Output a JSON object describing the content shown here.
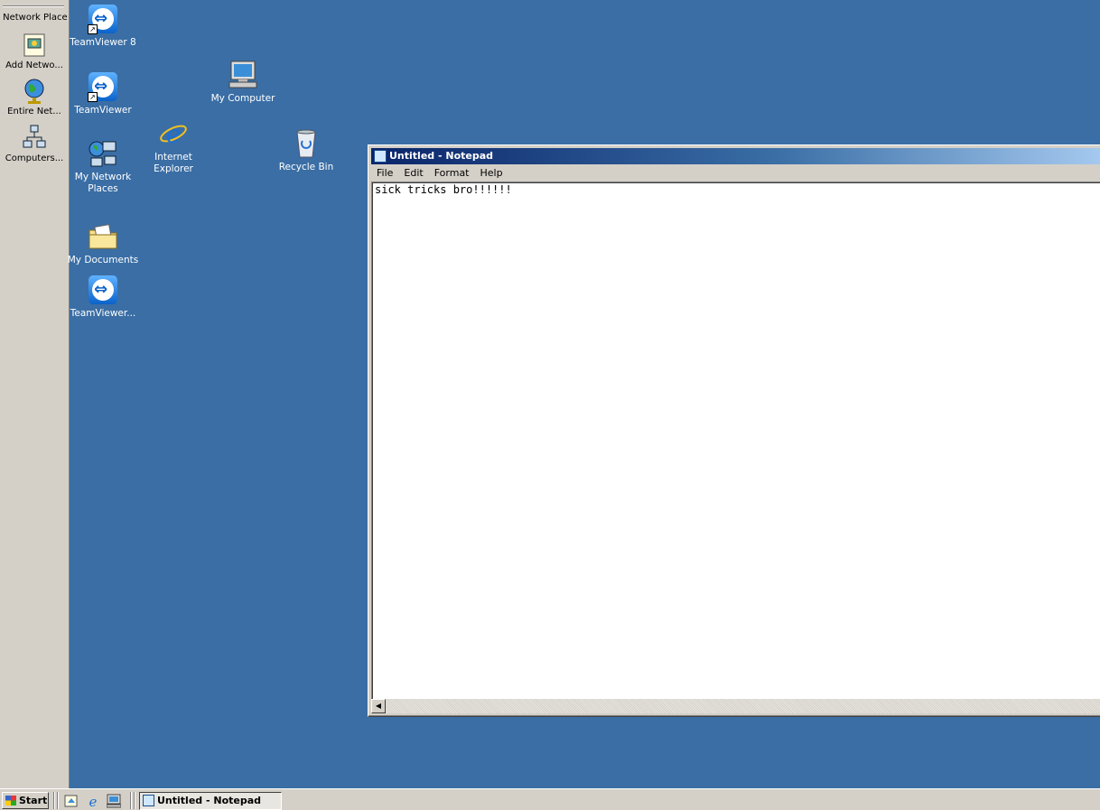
{
  "left_pane": {
    "title": "y Network Place",
    "items": [
      {
        "label": "Add Netwo..."
      },
      {
        "label": "Entire Net..."
      },
      {
        "label": "Computers..."
      }
    ]
  },
  "desktop": {
    "icons": [
      {
        "label": "TeamViewer 8"
      },
      {
        "label": "TeamViewer"
      },
      {
        "label": "My Network Places"
      },
      {
        "label": "My Documents"
      },
      {
        "label": "TeamViewer..."
      },
      {
        "label": "Internet Explorer"
      },
      {
        "label": "My Computer"
      },
      {
        "label": "Recycle Bin"
      }
    ]
  },
  "notepad": {
    "title": "Untitled - Notepad",
    "menu": [
      "File",
      "Edit",
      "Format",
      "Help"
    ],
    "content": "sick tricks bro!!!!!!"
  },
  "taskbar": {
    "start_label": "Start",
    "task_label": "Untitled - Notepad"
  }
}
